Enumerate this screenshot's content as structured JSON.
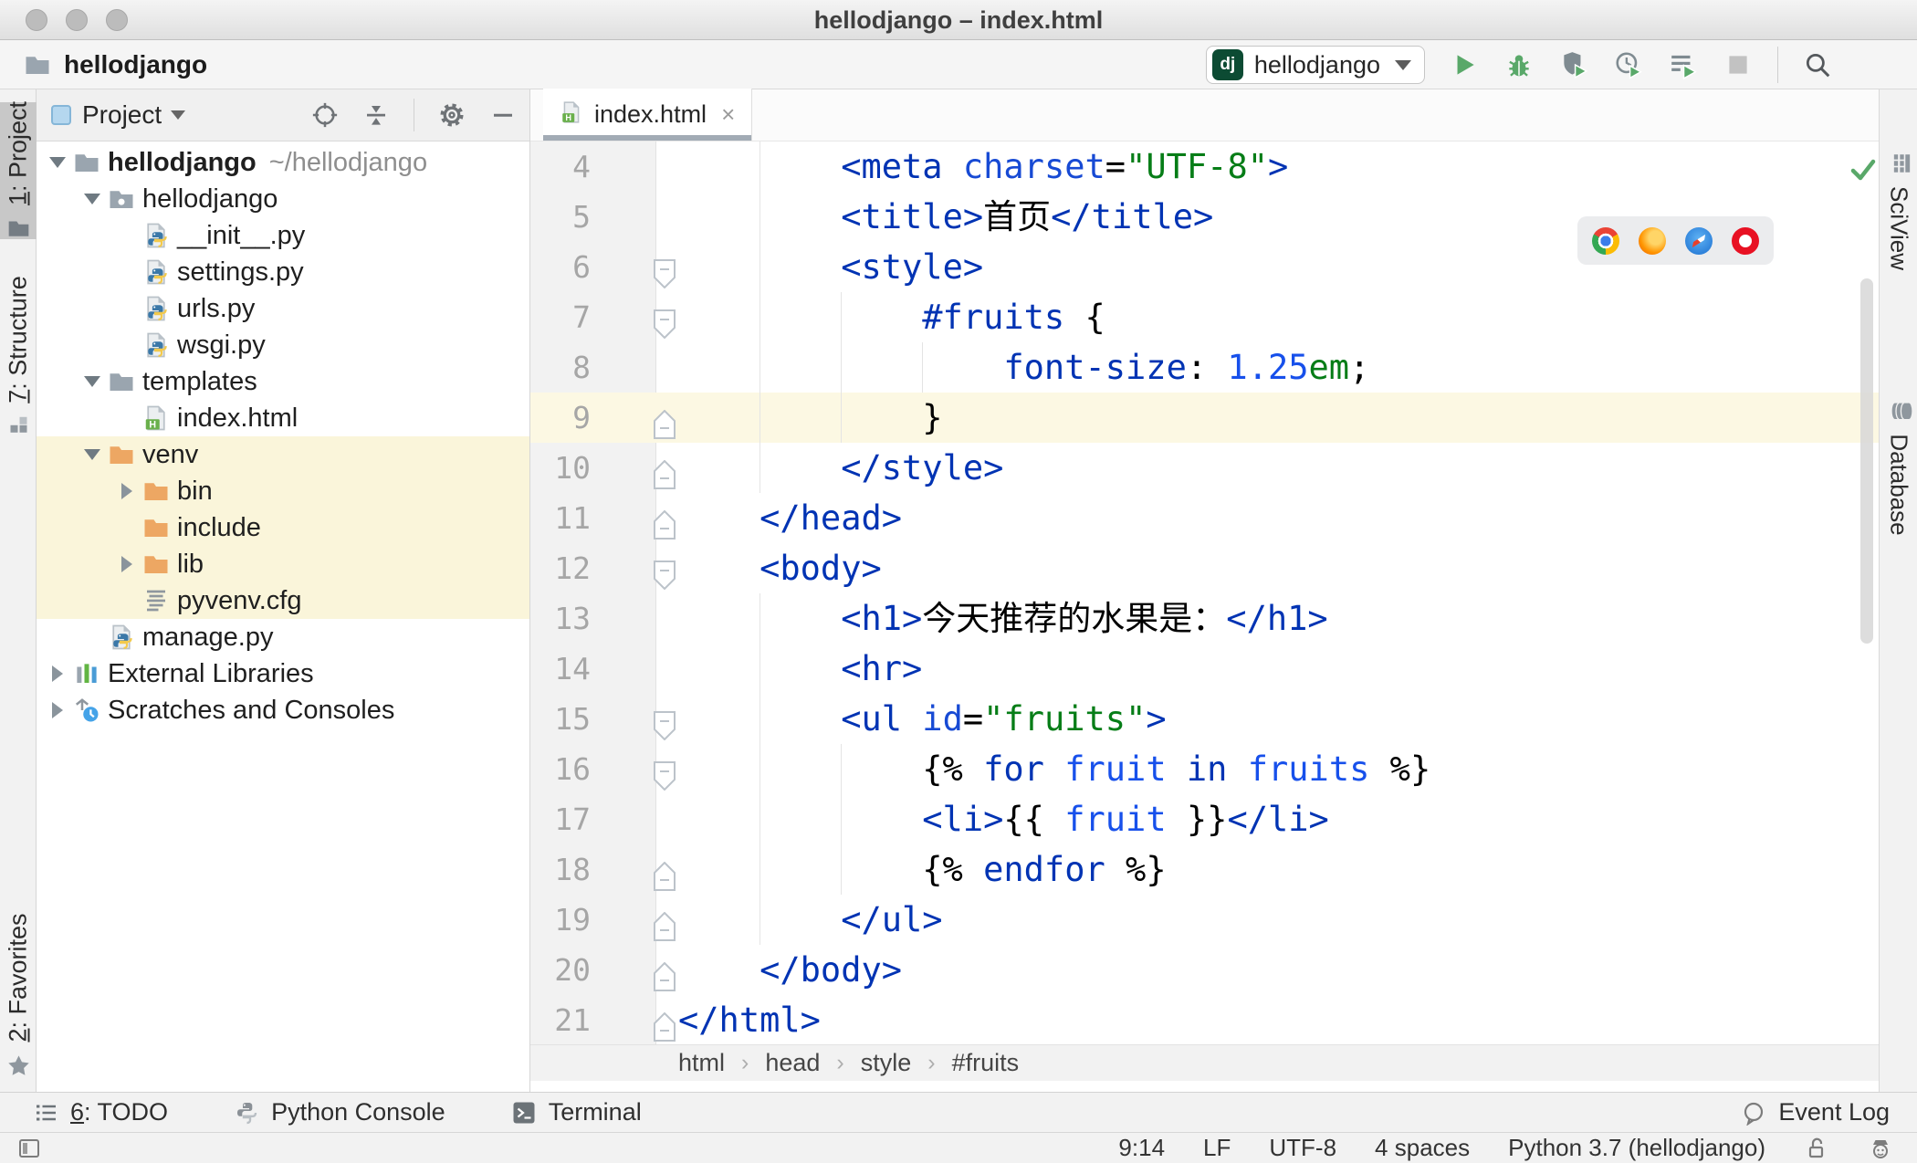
{
  "window": {
    "title": "hellodjango – index.html"
  },
  "toolbar": {
    "project_name": "hellodjango",
    "run_config": {
      "badge": "dj",
      "label": "hellodjango"
    },
    "actions": [
      {
        "name": "run-button",
        "icon": "play"
      },
      {
        "name": "debug-button",
        "icon": "bug"
      },
      {
        "name": "coverage-button",
        "icon": "shield-play"
      },
      {
        "name": "profiler-button",
        "icon": "clock-play"
      },
      {
        "name": "run-with-button",
        "icon": "list-play"
      },
      {
        "name": "stop-button",
        "icon": "stop"
      }
    ]
  },
  "left_stripe": {
    "project": "1: Project",
    "structure": "7: Structure",
    "favorites": "2: Favorites"
  },
  "right_stripe": {
    "sciview": "SciView",
    "database": "Database"
  },
  "project_panel": {
    "title": "Project",
    "actions": [
      {
        "name": "locate-button",
        "icon": "crosshair"
      },
      {
        "name": "collapse-all-button",
        "icon": "collapse"
      },
      {
        "name": "sep",
        "icon": "sep"
      },
      {
        "name": "settings-button",
        "icon": "gear"
      },
      {
        "name": "hide-button",
        "icon": "minus"
      }
    ],
    "tree": [
      {
        "label": "hellodjango",
        "hint": "~/hellodjango",
        "level": 0,
        "icon": "folder",
        "arrow": "down",
        "bold": true
      },
      {
        "label": "hellodjango",
        "level": 1,
        "icon": "package",
        "arrow": "down"
      },
      {
        "label": "__init__.py",
        "level": 2,
        "icon": "python"
      },
      {
        "label": "settings.py",
        "level": 2,
        "icon": "python"
      },
      {
        "label": "urls.py",
        "level": 2,
        "icon": "python"
      },
      {
        "label": "wsgi.py",
        "level": 2,
        "icon": "python"
      },
      {
        "label": "templates",
        "level": 1,
        "icon": "folder",
        "arrow": "down"
      },
      {
        "label": "index.html",
        "level": 2,
        "icon": "html"
      },
      {
        "label": "venv",
        "level": 1,
        "icon": "folder-ex",
        "arrow": "down",
        "hl": true
      },
      {
        "label": "bin",
        "level": 2,
        "icon": "folder-ex",
        "arrow": "right",
        "hl": true
      },
      {
        "label": "include",
        "level": 2,
        "icon": "folder-ex",
        "hl": true
      },
      {
        "label": "lib",
        "level": 2,
        "icon": "folder-ex",
        "arrow": "right",
        "hl": true
      },
      {
        "label": "pyvenv.cfg",
        "level": 2,
        "icon": "textfile",
        "hl": true
      },
      {
        "label": "manage.py",
        "level": 1,
        "icon": "python"
      },
      {
        "label": "External Libraries",
        "level": 0,
        "icon": "libs",
        "arrow": "right"
      },
      {
        "label": "Scratches and Consoles",
        "level": 0,
        "icon": "scratch",
        "arrow": "right"
      }
    ]
  },
  "editor": {
    "tab_label": "index.html",
    "browser_icons": [
      "chrome",
      "firefox",
      "safari",
      "opera"
    ],
    "breadcrumbs": [
      "html",
      "head",
      "style",
      "#fruits"
    ],
    "lines": [
      {
        "no": 4,
        "indent": 2,
        "fold": null,
        "tokens": [
          [
            "tag",
            "<meta"
          ],
          [
            "txt",
            " "
          ],
          [
            "attr",
            "charset"
          ],
          [
            "txt",
            "="
          ],
          [
            "str",
            "\"UTF-8\""
          ],
          [
            "tag",
            ">"
          ]
        ]
      },
      {
        "no": 5,
        "indent": 2,
        "fold": null,
        "tokens": [
          [
            "tag",
            "<title>"
          ],
          [
            "txt",
            "首页"
          ],
          [
            "tag",
            "</title>"
          ]
        ]
      },
      {
        "no": 6,
        "indent": 2,
        "fold": "down",
        "tokens": [
          [
            "tag",
            "<style>"
          ]
        ]
      },
      {
        "no": 7,
        "indent": 3,
        "fold": "down",
        "tokens": [
          [
            "tag",
            "#fruits"
          ],
          [
            "txt",
            " {"
          ]
        ]
      },
      {
        "no": 8,
        "indent": 4,
        "fold": null,
        "tokens": [
          [
            "tag",
            "font-size"
          ],
          [
            "txt",
            ": "
          ],
          [
            "num",
            "1.25"
          ],
          [
            "str",
            "em"
          ],
          [
            "txt",
            ";"
          ]
        ]
      },
      {
        "no": 9,
        "indent": 3,
        "fold": "up",
        "caret": true,
        "tokens": [
          [
            "txt",
            "}"
          ]
        ]
      },
      {
        "no": 10,
        "indent": 2,
        "fold": "up",
        "tokens": [
          [
            "tag",
            "</style>"
          ]
        ]
      },
      {
        "no": 11,
        "indent": 1,
        "fold": "up",
        "tokens": [
          [
            "tag",
            "</head>"
          ]
        ]
      },
      {
        "no": 12,
        "indent": 1,
        "fold": "down",
        "tokens": [
          [
            "tag",
            "<body>"
          ]
        ]
      },
      {
        "no": 13,
        "indent": 2,
        "fold": null,
        "tokens": [
          [
            "tag",
            "<h1>"
          ],
          [
            "txt",
            "今天推荐的水果是："
          ],
          [
            "tag",
            "</h1>"
          ]
        ]
      },
      {
        "no": 14,
        "indent": 2,
        "fold": null,
        "tokens": [
          [
            "tag",
            "<hr>"
          ]
        ]
      },
      {
        "no": 15,
        "indent": 2,
        "fold": "down",
        "tokens": [
          [
            "tag",
            "<ul"
          ],
          [
            "txt",
            " "
          ],
          [
            "attr",
            "id"
          ],
          [
            "txt",
            "="
          ],
          [
            "str",
            "\"fruits\""
          ],
          [
            "tag",
            ">"
          ]
        ]
      },
      {
        "no": 16,
        "indent": 3,
        "fold": "down",
        "tokens": [
          [
            "txt",
            "{% "
          ],
          [
            "kw",
            "for"
          ],
          [
            "txt",
            " "
          ],
          [
            "var",
            "fruit"
          ],
          [
            "txt",
            " "
          ],
          [
            "kw",
            "in"
          ],
          [
            "txt",
            " "
          ],
          [
            "var",
            "fruits"
          ],
          [
            "txt",
            " %}"
          ]
        ]
      },
      {
        "no": 17,
        "indent": 3,
        "fold": null,
        "tokens": [
          [
            "tag",
            "<li>"
          ],
          [
            "txt",
            "{{ "
          ],
          [
            "var",
            "fruit"
          ],
          [
            "txt",
            " }}"
          ],
          [
            "tag",
            "</li>"
          ]
        ]
      },
      {
        "no": 18,
        "indent": 3,
        "fold": "up",
        "tokens": [
          [
            "txt",
            "{% "
          ],
          [
            "kw",
            "endfor"
          ],
          [
            "txt",
            " %}"
          ]
        ]
      },
      {
        "no": 19,
        "indent": 2,
        "fold": "up",
        "tokens": [
          [
            "tag",
            "</ul>"
          ]
        ]
      },
      {
        "no": 20,
        "indent": 1,
        "fold": "up",
        "tokens": [
          [
            "tag",
            "</body>"
          ]
        ]
      },
      {
        "no": 21,
        "indent": 0,
        "fold": "up",
        "tokens": [
          [
            "tag",
            "</html>"
          ]
        ]
      }
    ]
  },
  "bottom_bar": {
    "items": [
      {
        "name": "todo",
        "icon": "todo",
        "label": "6: TODO"
      },
      {
        "name": "python-console",
        "icon": "pycon",
        "label": "Python Console"
      },
      {
        "name": "terminal",
        "icon": "terminal",
        "label": "Terminal"
      }
    ],
    "event_log": "Event Log"
  },
  "status_bar": {
    "caret_position": "9:14",
    "line_separator": "LF",
    "encoding": "UTF-8",
    "indent": "4 spaces",
    "interpreter": "Python 3.7 (hellodjango)"
  }
}
